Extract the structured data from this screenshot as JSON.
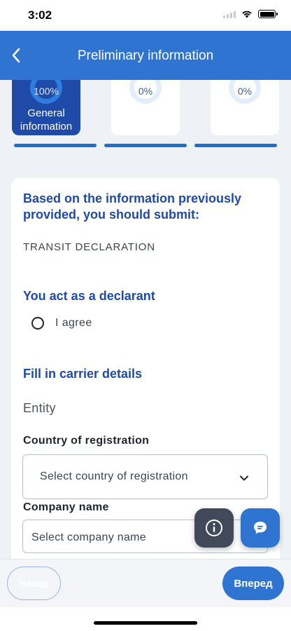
{
  "status_bar": {
    "time": "3:02"
  },
  "header": {
    "title": "Preliminary information"
  },
  "steps": [
    {
      "percent": "100%",
      "label_line1": "General",
      "label_line2": "information",
      "active": true
    },
    {
      "percent": "0%",
      "active": false
    },
    {
      "percent": "0%",
      "active": false
    }
  ],
  "card": {
    "intro_heading": "Based on the information previously provided, you should submit:",
    "declaration_type": "TRANSIT DECLARATION",
    "declarant_heading": "You act as a declarant",
    "agree_label": "I agree",
    "carrier_heading": "Fill in carrier details",
    "entity_label": "Entity",
    "country_label": "Country of registration",
    "country_placeholder": "Select country of registration",
    "company_label": "Company name",
    "company_placeholder": "Select company name"
  },
  "footer": {
    "back_label": "Назад",
    "next_label": "Вперед"
  },
  "colors": {
    "primary": "#2f74d0",
    "active_step": "#1f4aa8",
    "heading": "#1f4aa8"
  }
}
